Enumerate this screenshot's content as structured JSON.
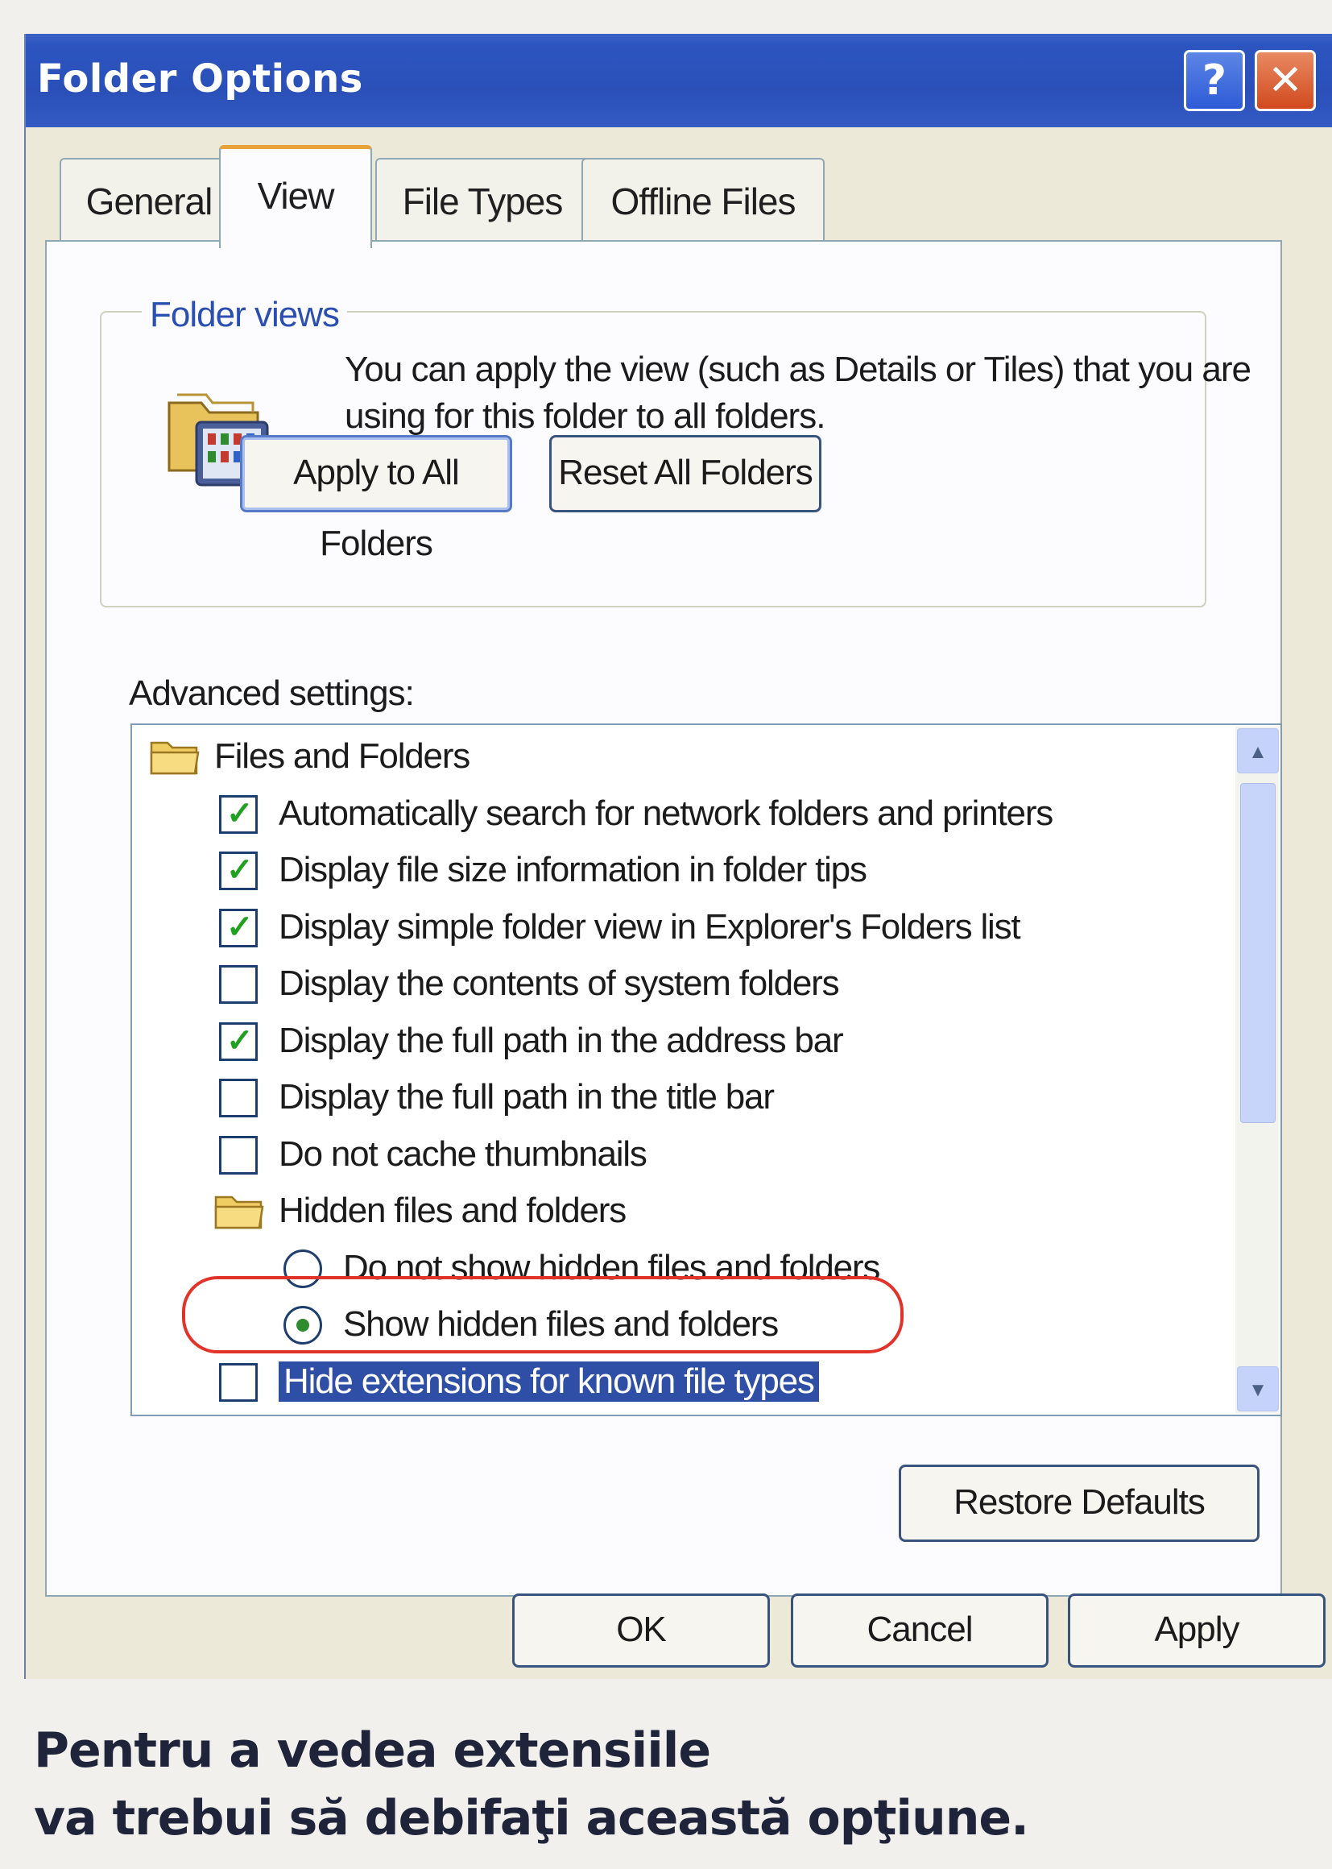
{
  "window": {
    "title": "Folder Options",
    "help_label": "?",
    "close_label": "✕"
  },
  "tabs": [
    {
      "label": "General",
      "active": false
    },
    {
      "label": "View",
      "active": true
    },
    {
      "label": "File Types",
      "active": false
    },
    {
      "label": "Offline Files",
      "active": false
    }
  ],
  "folder_views": {
    "legend": "Folder views",
    "description": "You can apply the view (such as Details or Tiles) that you are using for this folder to all folders.",
    "apply_button": "Apply to All Folders",
    "reset_button": "Reset All Folders"
  },
  "advanced": {
    "label": "Advanced settings:",
    "items": [
      {
        "kind": "folder",
        "label": "Files and Folders",
        "indent": 0
      },
      {
        "kind": "checkbox",
        "label": "Automatically search for network folders and printers",
        "checked": true,
        "indent": 1
      },
      {
        "kind": "checkbox",
        "label": "Display file size information in folder tips",
        "checked": true,
        "indent": 1
      },
      {
        "kind": "checkbox",
        "label": "Display simple folder view in Explorer's Folders list",
        "checked": true,
        "indent": 1
      },
      {
        "kind": "checkbox",
        "label": "Display the contents of system folders",
        "checked": false,
        "indent": 1
      },
      {
        "kind": "checkbox",
        "label": "Display the full path in the address bar",
        "checked": true,
        "indent": 1
      },
      {
        "kind": "checkbox",
        "label": "Display the full path in the title bar",
        "checked": false,
        "indent": 1
      },
      {
        "kind": "checkbox",
        "label": "Do not cache thumbnails",
        "checked": false,
        "indent": 1
      },
      {
        "kind": "folder",
        "label": "Hidden files and folders",
        "indent": 1
      },
      {
        "kind": "radio",
        "label": "Do not show hidden files and folders",
        "checked": false,
        "indent": 2
      },
      {
        "kind": "radio",
        "label": "Show hidden files and folders",
        "checked": true,
        "indent": 2
      },
      {
        "kind": "checkbox",
        "label": "Hide extensions for known file types",
        "checked": false,
        "selected": true,
        "indent": 1
      }
    ],
    "scroll_up_icon": "▲",
    "scroll_down_icon": "▼"
  },
  "restore_button": "Restore Defaults",
  "footer": {
    "ok": "OK",
    "cancel": "Cancel",
    "apply": "Apply"
  },
  "caption": {
    "line1": "Pentru a vedea extensiile",
    "line2": "va trebui să debifaţi această opţiune."
  },
  "colors": {
    "title_bar": "#2a50b8",
    "tab_accent": "#e8a23a",
    "selection": "#2f4fa7",
    "check_mark": "#21a121",
    "highlight_ring": "#e2332a"
  }
}
